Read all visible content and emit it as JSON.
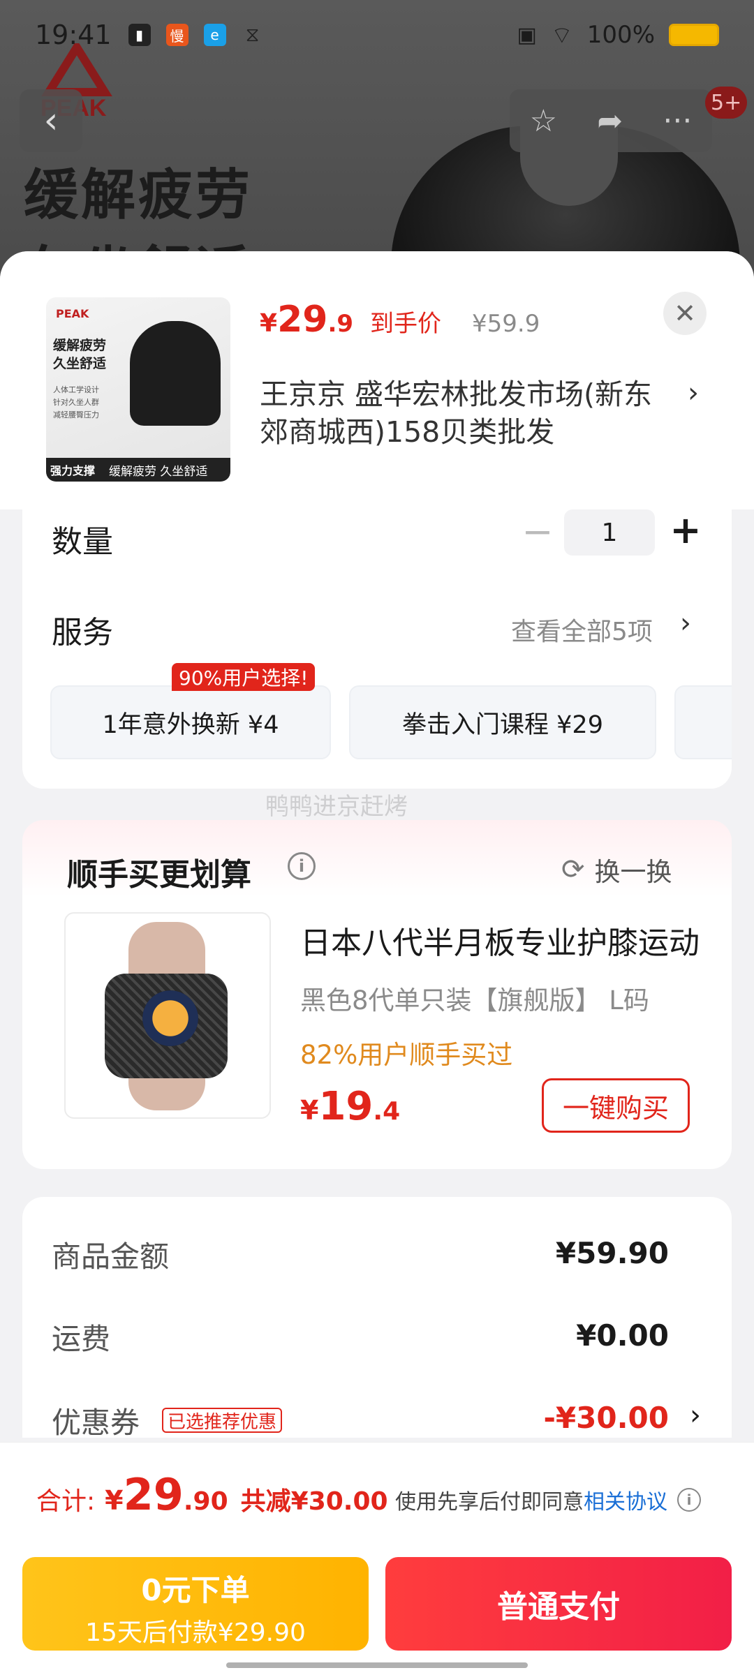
{
  "status_bar": {
    "time": "19:41",
    "battery": "100%"
  },
  "background": {
    "brand": "PEAK",
    "slogan_line1": "缓解疲劳",
    "slogan_line2": "久坐舒适",
    "cart_badge": "5+"
  },
  "product": {
    "thumb_brand": "PEAK",
    "thumb_line1": "缓解疲劳",
    "thumb_line2": "久坐舒适",
    "thumb_features": [
      "人体工学设计",
      "针对久坐人群",
      "减轻腰臀压力"
    ],
    "thumb_footer_left": "强力支撑",
    "thumb_footer_right": "缓解疲劳 久坐舒适",
    "price_yen": "¥",
    "price_int": "29",
    "price_dec": ".9",
    "price_tag": "到手价",
    "original_price": "¥59.9",
    "shop": "王京京  盛华宏林批发市场(新东郊商城西)158贝类批发"
  },
  "quantity": {
    "label": "数量",
    "value": "1",
    "minus": "−",
    "plus": "+"
  },
  "service": {
    "label": "服务",
    "view_all": "查看全部5项",
    "badge": "90%用户选择!",
    "items": [
      {
        "label": "1年意外换新  ¥4"
      },
      {
        "label": "拳击入门课程  ¥29"
      }
    ]
  },
  "watermark": "鸭鸭进京赶烤",
  "bundle": {
    "title": "顺手买更划算",
    "refresh": "换一换",
    "item": {
      "name": "日本八代半月板专业护膝运动",
      "spec": "黑色8代单只装【旗舰版】  L码",
      "percent": "82%用户顺手买过",
      "price_yen": "¥",
      "price_int": "19",
      "price_dec": ".4",
      "buy_label": "一键购买"
    }
  },
  "summary": {
    "goods_label": "商品金额",
    "goods_value": "¥59.90",
    "shipping_label": "运费",
    "shipping_value": "¥0.00",
    "coupon_label": "优惠券",
    "coupon_tag": "已选推荐优惠",
    "coupon_value": "-¥30.00"
  },
  "footer": {
    "total_label": "合计:",
    "total_yen": "¥",
    "total_int": "29",
    "total_dec": ".90",
    "total_save": "共减¥30.00",
    "agree_text": "使用先享后付即同意",
    "agree_link": "相关协议",
    "zero_line1": "0元下单",
    "zero_line2": "15天后付款¥29.90",
    "pay_label": "普通支付"
  },
  "colors": {
    "accent": "#e1251b",
    "orange": "#e08a1e",
    "pay_gradient_start": "#ff3d3d",
    "zero_gradient": "#ffb300"
  }
}
